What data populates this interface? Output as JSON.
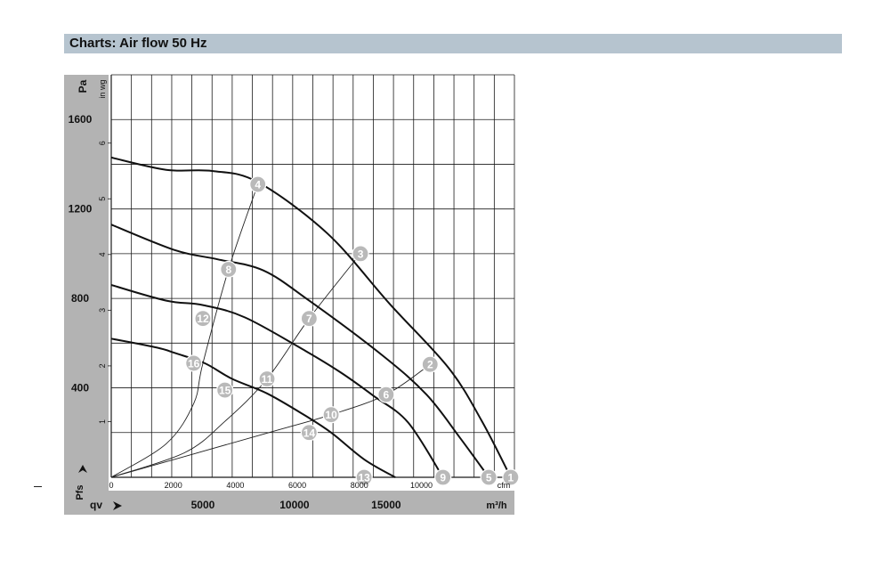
{
  "title": "Charts: Air flow 50 Hz",
  "dash": "–",
  "chart_data": {
    "type": "line",
    "title": "Charts: Air flow 50 Hz",
    "left_axis": {
      "label": "Pa",
      "ticks": [
        400,
        800,
        1200,
        1600
      ],
      "range": [
        0,
        1800
      ]
    },
    "inner_axis": {
      "label": "in wg",
      "ticks": [
        "1",
        "2",
        "3",
        "4",
        "5",
        "6"
      ]
    },
    "bottom_axis_inner": {
      "unit": "cfm",
      "ticks": [
        "0",
        "2000",
        "4000",
        "6000",
        "8000",
        "10000"
      ]
    },
    "bottom_axis_outer": {
      "label": "qv",
      "unit": "m³/h",
      "ticks": [
        "5000",
        "10000",
        "15000"
      ],
      "range": [
        0,
        22000
      ]
    },
    "y_axis_label_bottom": "Pfs",
    "grid": true,
    "series": [
      {
        "points": [
          [
            0,
            1430
          ],
          [
            3000,
            1375
          ],
          [
            5500,
            1370
          ],
          [
            8000,
            1320
          ],
          [
            11800,
            1090
          ],
          [
            15200,
            775
          ],
          [
            18400,
            490
          ],
          [
            20200,
            255
          ],
          [
            21800,
            0
          ]
        ]
      },
      {
        "points": [
          [
            0,
            1130
          ],
          [
            3500,
            1015
          ],
          [
            5800,
            975
          ],
          [
            8300,
            925
          ],
          [
            10800,
            790
          ],
          [
            14800,
            545
          ],
          [
            17200,
            370
          ],
          [
            19000,
            180
          ],
          [
            20600,
            0
          ]
        ]
      },
      {
        "points": [
          [
            0,
            860
          ],
          [
            3000,
            790
          ],
          [
            5000,
            770
          ],
          [
            7300,
            715
          ],
          [
            10600,
            565
          ],
          [
            12500,
            470
          ],
          [
            14300,
            365
          ],
          [
            16200,
            245
          ],
          [
            18100,
            0
          ]
        ]
      },
      {
        "points": [
          [
            0,
            620
          ],
          [
            2500,
            580
          ],
          [
            3500,
            555
          ],
          [
            5100,
            510
          ],
          [
            6600,
            440
          ],
          [
            8500,
            375
          ],
          [
            10600,
            275
          ],
          [
            12000,
            200
          ],
          [
            13800,
            80
          ],
          [
            15500,
            0
          ]
        ]
      }
    ],
    "curve_lines": [
      {
        "points": [
          [
            0,
            0
          ],
          [
            3000,
            150
          ],
          [
            4500,
            330
          ],
          [
            5000,
            510
          ],
          [
            6400,
            930
          ],
          [
            8000,
            1310
          ]
        ]
      },
      {
        "points": [
          [
            0,
            0
          ],
          [
            4000,
            110
          ],
          [
            6200,
            250
          ],
          [
            8500,
            440
          ],
          [
            10800,
            710
          ],
          [
            13600,
            1000
          ]
        ]
      },
      {
        "points": [
          [
            0,
            0
          ],
          [
            8600,
            200
          ],
          [
            12000,
            280
          ],
          [
            15000,
            370
          ],
          [
            17400,
            505
          ]
        ]
      }
    ],
    "point_labels": [
      {
        "label": "1",
        "x": 21800,
        "y": 0
      },
      {
        "label": "2",
        "x": 17400,
        "y": 505
      },
      {
        "label": "3",
        "x": 13600,
        "y": 1000
      },
      {
        "label": "4",
        "x": 8000,
        "y": 1310
      },
      {
        "label": "5",
        "x": 20600,
        "y": 0
      },
      {
        "label": "6",
        "x": 15000,
        "y": 370
      },
      {
        "label": "7",
        "x": 10800,
        "y": 710
      },
      {
        "label": "8",
        "x": 6400,
        "y": 930
      },
      {
        "label": "9",
        "x": 18100,
        "y": 0
      },
      {
        "label": "10",
        "x": 12000,
        "y": 280
      },
      {
        "label": "11",
        "x": 8500,
        "y": 440
      },
      {
        "label": "12",
        "x": 5000,
        "y": 710
      },
      {
        "label": "13",
        "x": 13800,
        "y": 0
      },
      {
        "label": "14",
        "x": 10800,
        "y": 200
      },
      {
        "label": "15",
        "x": 6200,
        "y": 390
      },
      {
        "label": "16",
        "x": 4500,
        "y": 510
      }
    ]
  }
}
